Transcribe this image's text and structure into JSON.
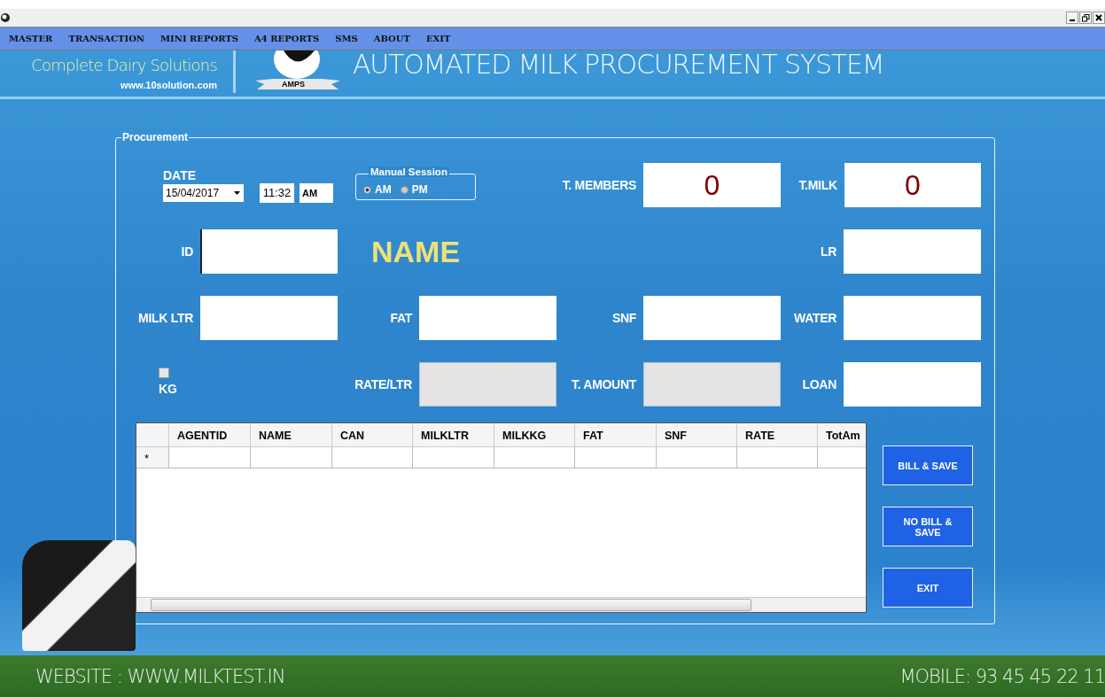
{
  "menu": [
    {
      "label": "MASTER"
    },
    {
      "label": "TRANSACTION"
    },
    {
      "label": "MINI REPORTS"
    },
    {
      "label": "A4 REPORTS"
    },
    {
      "label": "SMS"
    },
    {
      "label": "ABOUT"
    },
    {
      "label": "EXIT"
    }
  ],
  "header": {
    "tagline": "Complete Dairy Solutions",
    "website": "www.10solution.com",
    "logo_text": "AMPS",
    "title": "AUTOMATED MILK PROCUREMENT SYSTEM"
  },
  "procurement": {
    "title": "Procurement",
    "rows": [
      [
        {
          "kind": "date",
          "label": "DATE",
          "value": "15/04/2017",
          "time": "11:32",
          "ampm": "AM"
        },
        {
          "kind": "session",
          "title": "Manual Session",
          "options": [
            {
              "label": "AM",
              "selected": true
            },
            {
              "label": "PM",
              "selected": false
            }
          ]
        },
        {
          "kind": "stat",
          "label": "T. MEMBERS",
          "value": "0"
        },
        {
          "kind": "stat",
          "label": "T.MILK",
          "value": "0"
        }
      ],
      [
        {
          "kind": "field",
          "label": "ID",
          "focused": true,
          "disabled": false
        },
        {
          "kind": "name",
          "text": "NAME"
        },
        {
          "kind": "empty"
        },
        {
          "kind": "field",
          "label": "LR",
          "focused": false,
          "disabled": false
        }
      ],
      [
        {
          "kind": "field",
          "label": "MILK LTR",
          "focused": false,
          "disabled": false
        },
        {
          "kind": "field",
          "label": "FAT",
          "focused": false,
          "disabled": false
        },
        {
          "kind": "field",
          "label": "SNF",
          "focused": false,
          "disabled": false
        },
        {
          "kind": "field",
          "label": "WATER",
          "focused": false,
          "disabled": false
        }
      ],
      [
        {
          "kind": "checkbox",
          "label": "KG",
          "checked": false
        },
        {
          "kind": "field",
          "label": "RATE/LTR",
          "focused": false,
          "disabled": true
        },
        {
          "kind": "field",
          "label": "T. AMOUNT",
          "focused": false,
          "disabled": true
        },
        {
          "kind": "field",
          "label": "LOAN",
          "focused": false,
          "disabled": false
        }
      ]
    ],
    "table": {
      "columns": [
        "AGENTID",
        "NAME",
        "CAN",
        "MILKLTR",
        "MILKKG",
        "FAT",
        "SNF",
        "RATE",
        "TotAm"
      ],
      "new_row_marker": "*"
    },
    "buttons": [
      {
        "label": "BILL & SAVE"
      },
      {
        "label": "NO BILL & SAVE"
      },
      {
        "label": "EXIT"
      }
    ]
  },
  "footer": {
    "website": "WEBSITE : WWW.MILKTEST.IN",
    "mobile": "MOBILE: 93 45 45 22 11"
  }
}
